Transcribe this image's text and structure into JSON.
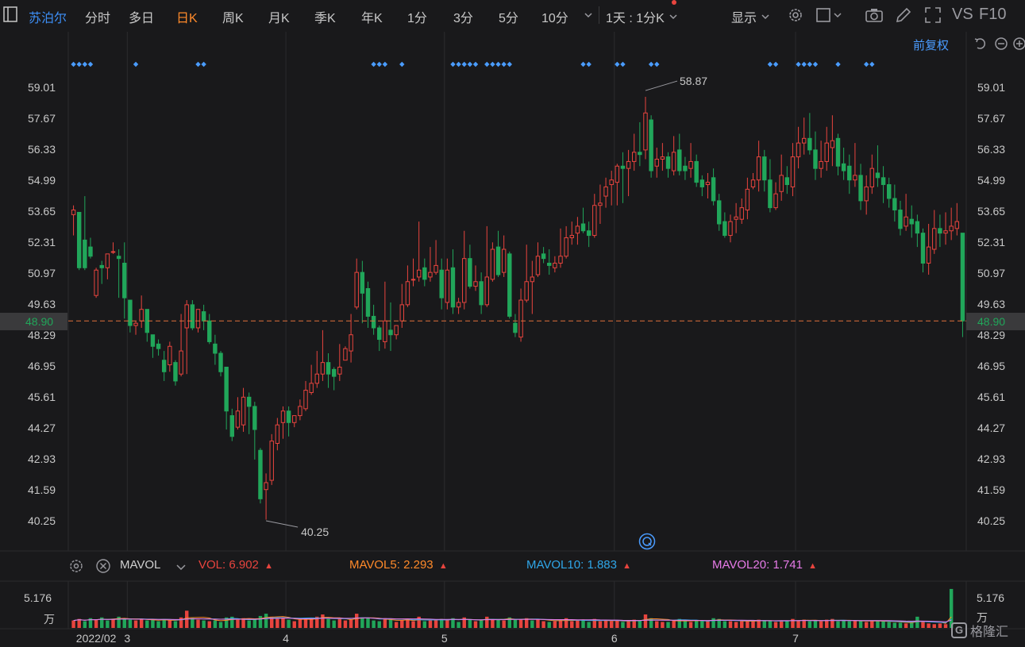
{
  "toolbar": {
    "stock_name": "苏泊尔",
    "tabs": [
      "分时",
      "多日",
      "日K",
      "周K",
      "月K",
      "季K",
      "年K",
      "1分",
      "3分",
      "5分",
      "10分"
    ],
    "active_tab": "日K",
    "interval_label": "1天 : 1分K",
    "display_label": "显示",
    "vs_label": "VS",
    "f10_label": "F10"
  },
  "adjust_label": "前复权",
  "indicator_bar": {
    "name": "MAVOL",
    "vol_label": "VOL:",
    "vol_value": "6.902",
    "mavol5_label": "MAVOL5:",
    "mavol5_value": "2.293",
    "mavol10_label": "MAVOL10:",
    "mavol10_value": "1.883",
    "mavol20_label": "MAVOL20:",
    "mavol20_value": "1.741"
  },
  "colors": {
    "up": "#e8443e",
    "down": "#21a65a",
    "marker": "#4a9cff",
    "mavol5": "#ff8a2a",
    "mavol10": "#2fa6e8",
    "mavol20": "#e77be8",
    "last_price": "#21a65a"
  },
  "chart_data": {
    "type": "candlestick",
    "y_ticks": [
      "59.01",
      "57.67",
      "56.33",
      "54.99",
      "53.65",
      "52.31",
      "50.97",
      "49.63",
      "48.29",
      "46.95",
      "45.61",
      "44.27",
      "42.93",
      "41.59",
      "40.25"
    ],
    "ylim": [
      40.25,
      59.01
    ],
    "last_price": "48.90",
    "high_annotation": "58.87",
    "low_annotation": "40.25",
    "x_labels": [
      "2022/02",
      "3",
      "4",
      "5",
      "6",
      "7"
    ],
    "volume_axis_value": "5.176",
    "volume_axis_unit": "万",
    "candles": [
      [
        53.5,
        53.7,
        53.9,
        52.6
      ],
      [
        53.6,
        51.2,
        53.6,
        51.1
      ],
      [
        52.4,
        51.2,
        54.3,
        51.1
      ],
      [
        52.1,
        51.7,
        52.5,
        51.6
      ],
      [
        50.0,
        51.1,
        51.2,
        49.9
      ],
      [
        51.3,
        51.2,
        51.5,
        50.5
      ],
      [
        51.2,
        51.8,
        51.8,
        50.7
      ],
      [
        51.9,
        51.9,
        52.3,
        51.8
      ],
      [
        51.7,
        51.6,
        52.0,
        49.9
      ],
      [
        51.4,
        49.9,
        52.3,
        49.0
      ],
      [
        49.8,
        48.7,
        49.8,
        48.4
      ],
      [
        48.7,
        48.8,
        48.9,
        48.3
      ],
      [
        48.9,
        49.4,
        50.0,
        48.6
      ],
      [
        49.4,
        48.4,
        49.4,
        48.0
      ],
      [
        48.3,
        47.8,
        48.3,
        47.3
      ],
      [
        47.9,
        47.7,
        48.1,
        47.4
      ],
      [
        47.2,
        46.7,
        47.6,
        46.3
      ],
      [
        47.0,
        47.8,
        48.0,
        46.7
      ],
      [
        47.1,
        46.3,
        47.2,
        46.1
      ],
      [
        46.6,
        47.6,
        49.2,
        46.5
      ],
      [
        48.6,
        49.6,
        49.8,
        46.6
      ],
      [
        49.6,
        48.6,
        49.8,
        48.5
      ],
      [
        48.6,
        49.4,
        49.4,
        48.4
      ],
      [
        49.3,
        48.9,
        49.6,
        48.5
      ],
      [
        48.9,
        48.0,
        49.2,
        47.9
      ],
      [
        47.9,
        47.5,
        48.3,
        47.0
      ],
      [
        47.5,
        46.7,
        47.6,
        46.5
      ],
      [
        46.9,
        45.0,
        46.9,
        44.2
      ],
      [
        44.8,
        43.9,
        45.1,
        43.7
      ],
      [
        44.3,
        45.0,
        45.6,
        44.2
      ],
      [
        44.4,
        45.6,
        46.0,
        44.1
      ],
      [
        45.6,
        45.2,
        45.8,
        44.0
      ],
      [
        45.2,
        44.2,
        45.4,
        42.9
      ],
      [
        43.3,
        41.2,
        43.4,
        41.0
      ],
      [
        41.6,
        41.9,
        42.3,
        40.3
      ],
      [
        42.0,
        43.7,
        44.0,
        41.8
      ],
      [
        43.6,
        44.4,
        44.7,
        43.3
      ],
      [
        44.5,
        45.0,
        45.2,
        43.8
      ],
      [
        45.0,
        44.5,
        45.2,
        43.9
      ],
      [
        44.5,
        44.8,
        44.8,
        44.3
      ],
      [
        44.8,
        45.2,
        45.5,
        44.6
      ],
      [
        45.1,
        45.9,
        46.3,
        45.0
      ],
      [
        45.8,
        46.2,
        47.0,
        45.7
      ],
      [
        46.2,
        46.6,
        47.6,
        46.0
      ],
      [
        46.6,
        47.1,
        48.5,
        46.3
      ],
      [
        47.1,
        46.6,
        47.5,
        46.0
      ],
      [
        46.8,
        46.5,
        46.9,
        45.9
      ],
      [
        46.6,
        46.9,
        47.9,
        46.3
      ],
      [
        47.2,
        47.7,
        47.8,
        47.2
      ],
      [
        47.6,
        48.3,
        49.2,
        47.1
      ],
      [
        49.5,
        51.0,
        51.6,
        49.4
      ],
      [
        51.0,
        50.1,
        51.5,
        48.8
      ],
      [
        50.3,
        49.1,
        50.6,
        48.6
      ],
      [
        49.1,
        48.6,
        49.6,
        48.3
      ],
      [
        48.6,
        48.1,
        48.7,
        47.6
      ],
      [
        48.0,
        48.9,
        50.6,
        47.7
      ],
      [
        48.5,
        48.3,
        49.7,
        47.6
      ],
      [
        48.3,
        48.7,
        48.7,
        48.1
      ],
      [
        48.9,
        49.6,
        50.5,
        48.6
      ],
      [
        49.6,
        50.6,
        51.3,
        49.5
      ],
      [
        50.7,
        50.7,
        51.6,
        50.4
      ],
      [
        50.8,
        51.1,
        53.2,
        50.6
      ],
      [
        51.2,
        50.7,
        51.6,
        50.4
      ],
      [
        50.8,
        51.0,
        52.1,
        50.6
      ],
      [
        51.0,
        51.3,
        52.4,
        50.9
      ],
      [
        51.1,
        49.9,
        51.6,
        49.4
      ],
      [
        49.7,
        51.1,
        51.6,
        49.4
      ],
      [
        51.2,
        49.5,
        52.0,
        49.2
      ],
      [
        49.5,
        49.7,
        49.9,
        49.2
      ],
      [
        49.7,
        51.6,
        52.8,
        49.4
      ],
      [
        51.6,
        50.4,
        52.2,
        50.3
      ],
      [
        50.4,
        50.6,
        51.3,
        50.2
      ],
      [
        50.6,
        49.6,
        51.0,
        49.2
      ],
      [
        49.6,
        50.8,
        53.0,
        49.5
      ],
      [
        50.7,
        52.0,
        52.3,
        50.6
      ],
      [
        52.1,
        50.9,
        52.8,
        50.8
      ],
      [
        51.0,
        52.0,
        52.6,
        50.8
      ],
      [
        51.8,
        49.1,
        51.9,
        49.0
      ],
      [
        48.8,
        48.4,
        49.2,
        48.2
      ],
      [
        48.2,
        49.8,
        50.3,
        48.0
      ],
      [
        49.8,
        50.6,
        52.2,
        49.7
      ],
      [
        50.6,
        50.8,
        51.5,
        49.2
      ],
      [
        50.9,
        51.7,
        52.3,
        50.8
      ],
      [
        51.8,
        51.6,
        52.1,
        51.4
      ],
      [
        51.4,
        51.3,
        52.0,
        50.9
      ],
      [
        51.2,
        51.4,
        51.7,
        51.0
      ],
      [
        51.4,
        51.7,
        52.9,
        51.2
      ],
      [
        51.7,
        52.5,
        53.0,
        51.6
      ],
      [
        52.5,
        52.6,
        53.2,
        52.2
      ],
      [
        52.7,
        53.0,
        53.4,
        52.2
      ],
      [
        53.1,
        52.8,
        53.8,
        52.7
      ],
      [
        52.8,
        52.6,
        53.2,
        52.1
      ],
      [
        52.6,
        53.9,
        54.4,
        52.5
      ],
      [
        53.9,
        54.0,
        54.8,
        53.1
      ],
      [
        54.3,
        54.7,
        55.1,
        53.8
      ],
      [
        54.8,
        55.0,
        55.4,
        53.9
      ],
      [
        54.9,
        55.6,
        55.7,
        53.9
      ],
      [
        55.6,
        55.5,
        56.2,
        54.0
      ],
      [
        55.5,
        55.8,
        56.3,
        54.3
      ],
      [
        55.8,
        56.2,
        57.0,
        55.4
      ],
      [
        56.2,
        56.1,
        57.5,
        55.6
      ],
      [
        56.3,
        57.9,
        58.6,
        55.9
      ],
      [
        57.6,
        55.4,
        57.8,
        55.1
      ],
      [
        55.6,
        55.9,
        56.4,
        55.1
      ],
      [
        55.9,
        56.0,
        56.6,
        55.4
      ],
      [
        56.0,
        55.5,
        56.2,
        55.1
      ],
      [
        55.4,
        56.2,
        56.9,
        55.2
      ],
      [
        56.3,
        55.4,
        57.0,
        55.2
      ],
      [
        55.6,
        55.4,
        56.0,
        55.0
      ],
      [
        55.5,
        55.8,
        56.6,
        55.1
      ],
      [
        55.8,
        54.9,
        56.1,
        54.7
      ],
      [
        55.0,
        54.7,
        55.2,
        54.3
      ],
      [
        54.8,
        54.9,
        55.3,
        54.2
      ],
      [
        55.1,
        54.1,
        55.5,
        53.9
      ],
      [
        54.1,
        53.1,
        54.4,
        52.8
      ],
      [
        53.2,
        52.6,
        53.6,
        52.5
      ],
      [
        52.6,
        53.2,
        53.5,
        52.3
      ],
      [
        53.3,
        53.4,
        54.0,
        52.7
      ],
      [
        53.3,
        53.8,
        54.2,
        53.1
      ],
      [
        53.7,
        54.6,
        55.1,
        53.3
      ],
      [
        54.7,
        55.0,
        55.3,
        54.6
      ],
      [
        55.0,
        56.0,
        56.7,
        54.5
      ],
      [
        56.0,
        55.0,
        56.3,
        54.5
      ],
      [
        55.0,
        53.8,
        55.9,
        53.6
      ],
      [
        53.8,
        54.4,
        54.9,
        53.7
      ],
      [
        54.5,
        55.2,
        56.1,
        54.1
      ],
      [
        55.1,
        54.8,
        55.6,
        54.4
      ],
      [
        54.7,
        56.0,
        56.6,
        54.3
      ],
      [
        56.0,
        56.6,
        57.3,
        55.5
      ],
      [
        56.6,
        56.8,
        57.7,
        56.1
      ],
      [
        56.8,
        56.3,
        57.9,
        56.1
      ],
      [
        56.3,
        55.5,
        57.1,
        55.0
      ],
      [
        55.5,
        55.8,
        56.7,
        55.1
      ],
      [
        55.8,
        56.6,
        57.3,
        55.4
      ],
      [
        56.4,
        56.7,
        57.8,
        55.6
      ],
      [
        56.8,
        55.6,
        57.0,
        55.2
      ],
      [
        55.7,
        55.4,
        56.4,
        55.0
      ],
      [
        55.6,
        55.0,
        56.1,
        54.4
      ],
      [
        55.0,
        55.2,
        56.6,
        54.7
      ],
      [
        55.2,
        54.1,
        55.7,
        53.7
      ],
      [
        54.1,
        54.7,
        55.2,
        53.5
      ],
      [
        54.7,
        55.5,
        56.1,
        54.4
      ],
      [
        55.3,
        55.1,
        56.5,
        54.7
      ],
      [
        55.1,
        54.8,
        55.6,
        54.0
      ],
      [
        54.8,
        54.2,
        55.1,
        53.8
      ],
      [
        54.2,
        53.7,
        54.8,
        53.2
      ],
      [
        53.7,
        52.9,
        54.1,
        52.6
      ],
      [
        53.0,
        53.4,
        54.4,
        52.8
      ],
      [
        53.3,
        53.1,
        53.9,
        52.5
      ],
      [
        53.2,
        52.7,
        53.5,
        52.1
      ],
      [
        52.7,
        51.4,
        52.9,
        51.0
      ],
      [
        51.4,
        52.1,
        53.1,
        50.9
      ],
      [
        52.0,
        52.9,
        53.7,
        51.8
      ],
      [
        52.9,
        52.7,
        53.5,
        52.1
      ],
      [
        52.7,
        52.8,
        53.6,
        52.2
      ],
      [
        52.8,
        53.0,
        53.8,
        52.4
      ],
      [
        52.9,
        53.2,
        54.0,
        52.6
      ],
      [
        52.7,
        48.9,
        52.7,
        48.2
      ]
    ],
    "marker_groups": [
      [
        0,
        4
      ],
      [
        11,
        1
      ],
      [
        22,
        2
      ],
      [
        53,
        3
      ],
      [
        58,
        1
      ],
      [
        67,
        5
      ],
      [
        73,
        5
      ],
      [
        90,
        2
      ],
      [
        96,
        2
      ],
      [
        102,
        2
      ],
      [
        123,
        2
      ],
      [
        128,
        4
      ],
      [
        135,
        1
      ],
      [
        140,
        2
      ]
    ],
    "volumes": [
      [
        1.0,
        1
      ],
      [
        1.2,
        1
      ],
      [
        0.9,
        0
      ],
      [
        1.3,
        0
      ],
      [
        1.1,
        1
      ],
      [
        1.4,
        0
      ],
      [
        1.0,
        0
      ],
      [
        1.2,
        1
      ],
      [
        1.5,
        0
      ],
      [
        1.3,
        0
      ],
      [
        1.1,
        0
      ],
      [
        1.0,
        1
      ],
      [
        1.2,
        1
      ],
      [
        1.0,
        0
      ],
      [
        1.1,
        0
      ],
      [
        0.9,
        0
      ],
      [
        1.2,
        0
      ],
      [
        1.0,
        1
      ],
      [
        0.9,
        0
      ],
      [
        1.4,
        1
      ],
      [
        2.3,
        1
      ],
      [
        1.3,
        0
      ],
      [
        1.1,
        1
      ],
      [
        1.0,
        0
      ],
      [
        0.9,
        1
      ],
      [
        1.0,
        0
      ],
      [
        0.8,
        0
      ],
      [
        1.4,
        0
      ],
      [
        1.5,
        0
      ],
      [
        1.1,
        1
      ],
      [
        1.3,
        1
      ],
      [
        1.0,
        0
      ],
      [
        1.2,
        0
      ],
      [
        1.6,
        0
      ],
      [
        1.9,
        0
      ],
      [
        1.5,
        1
      ],
      [
        1.2,
        1
      ],
      [
        1.4,
        1
      ],
      [
        1.1,
        0
      ],
      [
        0.9,
        1
      ],
      [
        1.1,
        1
      ],
      [
        1.3,
        1
      ],
      [
        1.3,
        1
      ],
      [
        1.5,
        1
      ],
      [
        1.8,
        1
      ],
      [
        1.2,
        0
      ],
      [
        1.0,
        0
      ],
      [
        1.2,
        1
      ],
      [
        1.0,
        1
      ],
      [
        1.1,
        1
      ],
      [
        1.9,
        1
      ],
      [
        1.4,
        0
      ],
      [
        1.3,
        0
      ],
      [
        1.0,
        0
      ],
      [
        0.9,
        0
      ],
      [
        1.3,
        1
      ],
      [
        1.1,
        0
      ],
      [
        0.8,
        1
      ],
      [
        1.0,
        1
      ],
      [
        1.2,
        1
      ],
      [
        0.9,
        1
      ],
      [
        1.5,
        1
      ],
      [
        0.9,
        0
      ],
      [
        1.0,
        1
      ],
      [
        1.1,
        1
      ],
      [
        1.2,
        0
      ],
      [
        1.1,
        1
      ],
      [
        1.3,
        0
      ],
      [
        0.8,
        0
      ],
      [
        1.4,
        1
      ],
      [
        1.1,
        0
      ],
      [
        0.9,
        1
      ],
      [
        1.0,
        0
      ],
      [
        1.5,
        1
      ],
      [
        1.2,
        1
      ],
      [
        1.1,
        0
      ],
      [
        1.0,
        1
      ],
      [
        1.4,
        0
      ],
      [
        1.1,
        0
      ],
      [
        1.2,
        1
      ],
      [
        1.3,
        1
      ],
      [
        1.0,
        0
      ],
      [
        1.2,
        1
      ],
      [
        0.9,
        1
      ],
      [
        0.8,
        0
      ],
      [
        0.9,
        1
      ],
      [
        1.1,
        1
      ],
      [
        1.3,
        1
      ],
      [
        0.9,
        1
      ],
      [
        1.0,
        1
      ],
      [
        1.1,
        0
      ],
      [
        0.8,
        0
      ],
      [
        1.2,
        1
      ],
      [
        0.9,
        1
      ],
      [
        1.0,
        1
      ],
      [
        0.9,
        1
      ],
      [
        1.0,
        1
      ],
      [
        0.8,
        0
      ],
      [
        0.9,
        1
      ],
      [
        1.1,
        1
      ],
      [
        1.0,
        0
      ],
      [
        1.8,
        1
      ],
      [
        1.3,
        0
      ],
      [
        0.9,
        1
      ],
      [
        0.8,
        1
      ],
      [
        0.8,
        0
      ],
      [
        1.0,
        1
      ],
      [
        1.2,
        0
      ],
      [
        0.9,
        0
      ],
      [
        0.8,
        1
      ],
      [
        1.0,
        0
      ],
      [
        0.9,
        0
      ],
      [
        1.0,
        1
      ],
      [
        1.3,
        0
      ],
      [
        1.2,
        0
      ],
      [
        0.9,
        0
      ],
      [
        0.9,
        1
      ],
      [
        0.8,
        1
      ],
      [
        0.9,
        1
      ],
      [
        1.0,
        1
      ],
      [
        0.9,
        1
      ],
      [
        1.1,
        1
      ],
      [
        1.0,
        0
      ],
      [
        0.9,
        0
      ],
      [
        0.8,
        1
      ],
      [
        1.0,
        1
      ],
      [
        0.9,
        0
      ],
      [
        1.2,
        1
      ],
      [
        1.0,
        1
      ],
      [
        1.1,
        1
      ],
      [
        0.9,
        0
      ],
      [
        1.0,
        0
      ],
      [
        0.9,
        1
      ],
      [
        1.1,
        1
      ],
      [
        1.2,
        1
      ],
      [
        0.9,
        0
      ],
      [
        1.0,
        0
      ],
      [
        0.9,
        0
      ],
      [
        1.0,
        1
      ],
      [
        0.9,
        0
      ],
      [
        0.8,
        1
      ],
      [
        1.0,
        1
      ],
      [
        0.9,
        0
      ],
      [
        0.9,
        0
      ],
      [
        0.8,
        0
      ],
      [
        0.7,
        0
      ],
      [
        0.7,
        0
      ],
      [
        0.6,
        1
      ],
      [
        0.7,
        0
      ],
      [
        1.5,
        0
      ],
      [
        0.8,
        1
      ],
      [
        0.6,
        1
      ],
      [
        0.5,
        1
      ],
      [
        0.6,
        1
      ],
      [
        0.5,
        1
      ],
      [
        5.2,
        0
      ]
    ]
  }
}
